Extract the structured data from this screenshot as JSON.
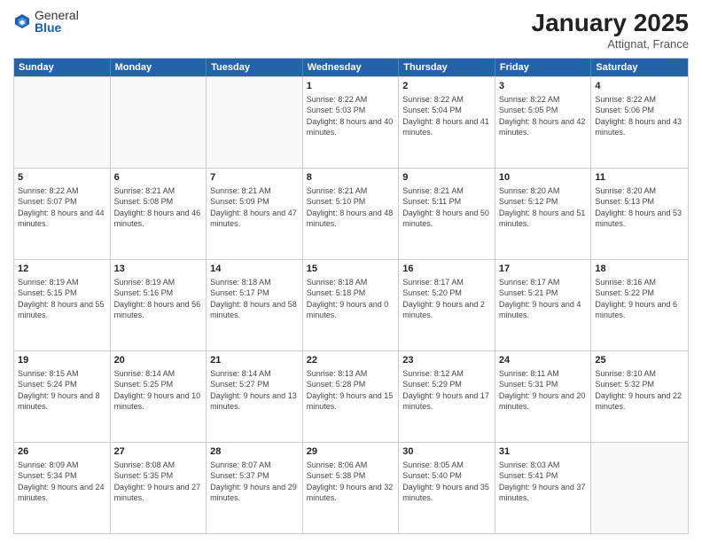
{
  "logo": {
    "general": "General",
    "blue": "Blue"
  },
  "header": {
    "title": "January 2025",
    "location": "Attignat, France"
  },
  "weekdays": [
    "Sunday",
    "Monday",
    "Tuesday",
    "Wednesday",
    "Thursday",
    "Friday",
    "Saturday"
  ],
  "weeks": [
    [
      {
        "day": "",
        "text": ""
      },
      {
        "day": "",
        "text": ""
      },
      {
        "day": "",
        "text": ""
      },
      {
        "day": "1",
        "text": "Sunrise: 8:22 AM\nSunset: 5:03 PM\nDaylight: 8 hours\nand 40 minutes."
      },
      {
        "day": "2",
        "text": "Sunrise: 8:22 AM\nSunset: 5:04 PM\nDaylight: 8 hours\nand 41 minutes."
      },
      {
        "day": "3",
        "text": "Sunrise: 8:22 AM\nSunset: 5:05 PM\nDaylight: 8 hours\nand 42 minutes."
      },
      {
        "day": "4",
        "text": "Sunrise: 8:22 AM\nSunset: 5:06 PM\nDaylight: 8 hours\nand 43 minutes."
      }
    ],
    [
      {
        "day": "5",
        "text": "Sunrise: 8:22 AM\nSunset: 5:07 PM\nDaylight: 8 hours\nand 44 minutes."
      },
      {
        "day": "6",
        "text": "Sunrise: 8:21 AM\nSunset: 5:08 PM\nDaylight: 8 hours\nand 46 minutes."
      },
      {
        "day": "7",
        "text": "Sunrise: 8:21 AM\nSunset: 5:09 PM\nDaylight: 8 hours\nand 47 minutes."
      },
      {
        "day": "8",
        "text": "Sunrise: 8:21 AM\nSunset: 5:10 PM\nDaylight: 8 hours\nand 48 minutes."
      },
      {
        "day": "9",
        "text": "Sunrise: 8:21 AM\nSunset: 5:11 PM\nDaylight: 8 hours\nand 50 minutes."
      },
      {
        "day": "10",
        "text": "Sunrise: 8:20 AM\nSunset: 5:12 PM\nDaylight: 8 hours\nand 51 minutes."
      },
      {
        "day": "11",
        "text": "Sunrise: 8:20 AM\nSunset: 5:13 PM\nDaylight: 8 hours\nand 53 minutes."
      }
    ],
    [
      {
        "day": "12",
        "text": "Sunrise: 8:19 AM\nSunset: 5:15 PM\nDaylight: 8 hours\nand 55 minutes."
      },
      {
        "day": "13",
        "text": "Sunrise: 8:19 AM\nSunset: 5:16 PM\nDaylight: 8 hours\nand 56 minutes."
      },
      {
        "day": "14",
        "text": "Sunrise: 8:18 AM\nSunset: 5:17 PM\nDaylight: 8 hours\nand 58 minutes."
      },
      {
        "day": "15",
        "text": "Sunrise: 8:18 AM\nSunset: 5:18 PM\nDaylight: 9 hours\nand 0 minutes."
      },
      {
        "day": "16",
        "text": "Sunrise: 8:17 AM\nSunset: 5:20 PM\nDaylight: 9 hours\nand 2 minutes."
      },
      {
        "day": "17",
        "text": "Sunrise: 8:17 AM\nSunset: 5:21 PM\nDaylight: 9 hours\nand 4 minutes."
      },
      {
        "day": "18",
        "text": "Sunrise: 8:16 AM\nSunset: 5:22 PM\nDaylight: 9 hours\nand 6 minutes."
      }
    ],
    [
      {
        "day": "19",
        "text": "Sunrise: 8:15 AM\nSunset: 5:24 PM\nDaylight: 9 hours\nand 8 minutes."
      },
      {
        "day": "20",
        "text": "Sunrise: 8:14 AM\nSunset: 5:25 PM\nDaylight: 9 hours\nand 10 minutes."
      },
      {
        "day": "21",
        "text": "Sunrise: 8:14 AM\nSunset: 5:27 PM\nDaylight: 9 hours\nand 13 minutes."
      },
      {
        "day": "22",
        "text": "Sunrise: 8:13 AM\nSunset: 5:28 PM\nDaylight: 9 hours\nand 15 minutes."
      },
      {
        "day": "23",
        "text": "Sunrise: 8:12 AM\nSunset: 5:29 PM\nDaylight: 9 hours\nand 17 minutes."
      },
      {
        "day": "24",
        "text": "Sunrise: 8:11 AM\nSunset: 5:31 PM\nDaylight: 9 hours\nand 20 minutes."
      },
      {
        "day": "25",
        "text": "Sunrise: 8:10 AM\nSunset: 5:32 PM\nDaylight: 9 hours\nand 22 minutes."
      }
    ],
    [
      {
        "day": "26",
        "text": "Sunrise: 8:09 AM\nSunset: 5:34 PM\nDaylight: 9 hours\nand 24 minutes."
      },
      {
        "day": "27",
        "text": "Sunrise: 8:08 AM\nSunset: 5:35 PM\nDaylight: 9 hours\nand 27 minutes."
      },
      {
        "day": "28",
        "text": "Sunrise: 8:07 AM\nSunset: 5:37 PM\nDaylight: 9 hours\nand 29 minutes."
      },
      {
        "day": "29",
        "text": "Sunrise: 8:06 AM\nSunset: 5:38 PM\nDaylight: 9 hours\nand 32 minutes."
      },
      {
        "day": "30",
        "text": "Sunrise: 8:05 AM\nSunset: 5:40 PM\nDaylight: 9 hours\nand 35 minutes."
      },
      {
        "day": "31",
        "text": "Sunrise: 8:03 AM\nSunset: 5:41 PM\nDaylight: 9 hours\nand 37 minutes."
      },
      {
        "day": "",
        "text": ""
      }
    ]
  ]
}
